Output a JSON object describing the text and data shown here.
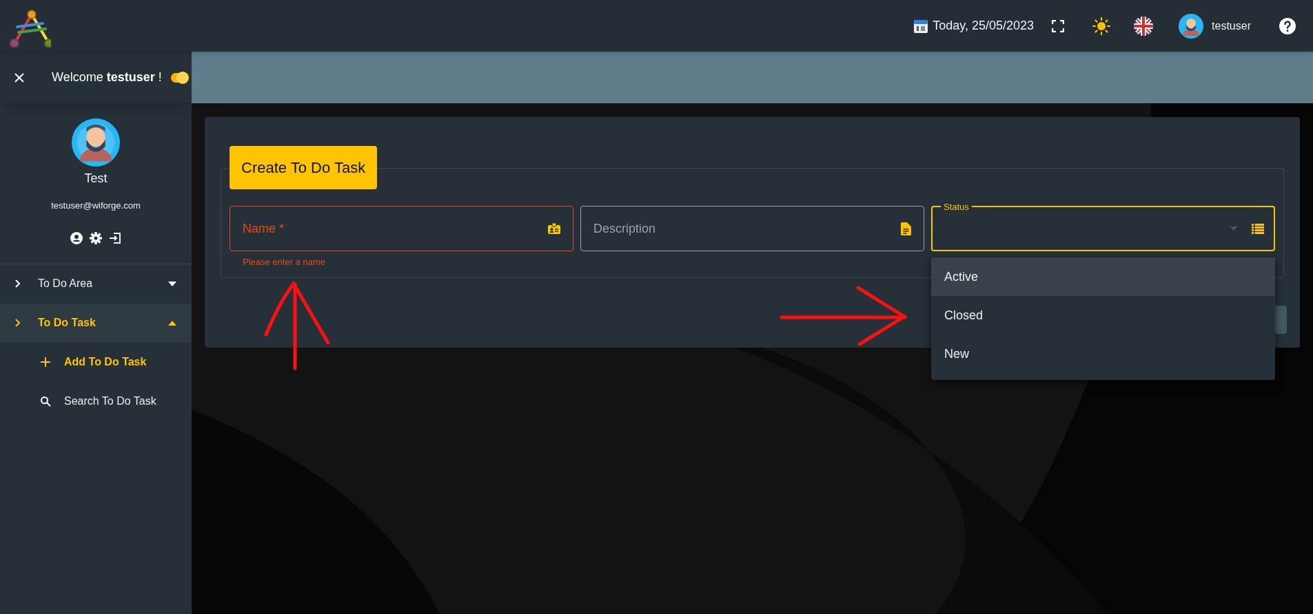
{
  "topbar": {
    "date": "Today, 25/05/2023",
    "username": "testuser"
  },
  "sidebar": {
    "welcome": "Welcome **testuser** !",
    "toggle": {
      "on": true
    },
    "profile_name": "Test",
    "email": "testuser@wiforge.com",
    "menu": [
      {
        "label": "To Do Area",
        "expanded": false,
        "selected": false
      },
      {
        "label": "To Do Task",
        "expanded": true,
        "selected": true,
        "children": [
          {
            "kind": "add",
            "label": "Add To Do Task",
            "selected": true
          },
          {
            "kind": "search",
            "label": "Search To Do Task",
            "selected": false
          }
        ]
      }
    ]
  },
  "form": {
    "title": "Create To Do Task",
    "fields": [
      {
        "kind": "text",
        "label": "Name *",
        "invalid": true,
        "error": "Please enter a name"
      },
      {
        "kind": "text",
        "label": "Description",
        "invalid": false
      },
      {
        "kind": "select",
        "label": "Status",
        "focused": true,
        "open": true,
        "options": [
          {
            "label": "Active",
            "selected": true
          },
          {
            "label": "Closed",
            "selected": false
          },
          {
            "label": "New",
            "selected": false
          }
        ]
      }
    ]
  }
}
